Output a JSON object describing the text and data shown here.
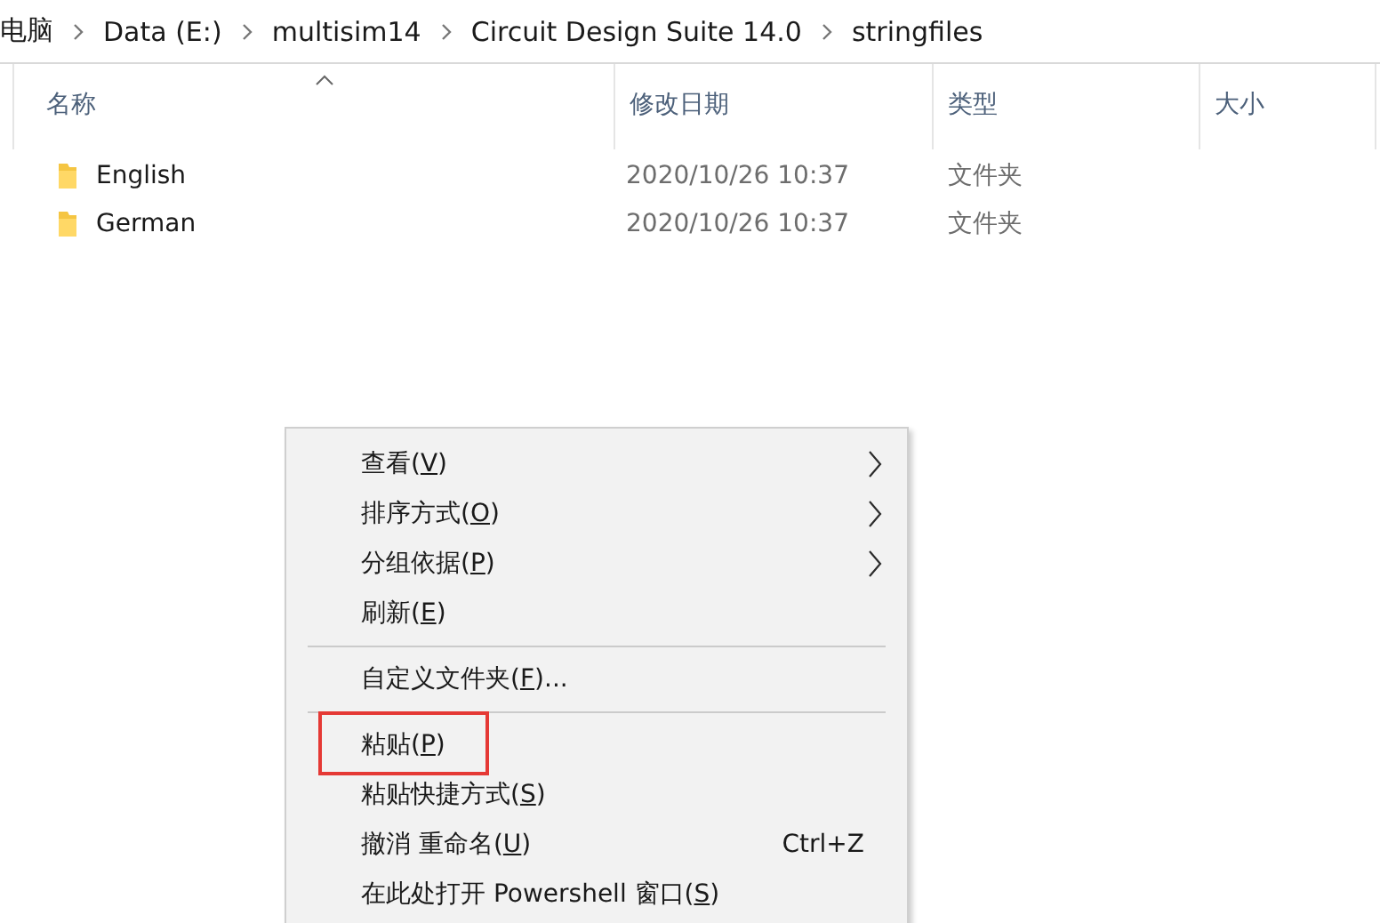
{
  "breadcrumb": [
    "电脑",
    "Data (E:)",
    "multisim14",
    "Circuit Design Suite 14.0",
    "stringfiles"
  ],
  "columns": [
    {
      "label": "名称",
      "sorted": true
    },
    {
      "label": "修改日期",
      "sorted": false
    },
    {
      "label": "类型",
      "sorted": false
    },
    {
      "label": "大小",
      "sorted": false
    }
  ],
  "rows": [
    {
      "name": "English",
      "modified": "2020/10/26 10:37",
      "type": "文件夹"
    },
    {
      "name": "German",
      "modified": "2020/10/26 10:37",
      "type": "文件夹"
    }
  ],
  "context_menu": [
    {
      "kind": "item",
      "label_start": "查看(",
      "access_key": "V",
      "label_end": ")",
      "submenu": true,
      "highlighted": false
    },
    {
      "kind": "item",
      "label_start": "排序方式(",
      "access_key": "O",
      "label_end": ")",
      "submenu": true,
      "highlighted": false
    },
    {
      "kind": "item",
      "label_start": "分组依据(",
      "access_key": "P",
      "label_end": ")",
      "submenu": true,
      "highlighted": false
    },
    {
      "kind": "item",
      "label_start": "刷新(",
      "access_key": "E",
      "label_end": ")",
      "submenu": false,
      "highlighted": false
    },
    {
      "kind": "separator"
    },
    {
      "kind": "item",
      "label_start": "自定义文件夹(",
      "access_key": "F",
      "label_end": ")...",
      "submenu": false,
      "highlighted": false
    },
    {
      "kind": "separator"
    },
    {
      "kind": "item",
      "label_start": "粘贴(",
      "access_key": "P",
      "label_end": ")",
      "submenu": false,
      "highlighted": true
    },
    {
      "kind": "item",
      "label_start": "粘贴快捷方式(",
      "access_key": "S",
      "label_end": ")",
      "submenu": false,
      "highlighted": false
    },
    {
      "kind": "item",
      "label_start": "撤消 重命名(",
      "access_key": "U",
      "label_end": ")",
      "shortcut": "Ctrl+Z",
      "submenu": false,
      "highlighted": false
    },
    {
      "kind": "item",
      "label_start": "在此处打开 Powershell 窗口(",
      "access_key": "S",
      "label_end": ")",
      "submenu": false,
      "highlighted": false
    }
  ]
}
